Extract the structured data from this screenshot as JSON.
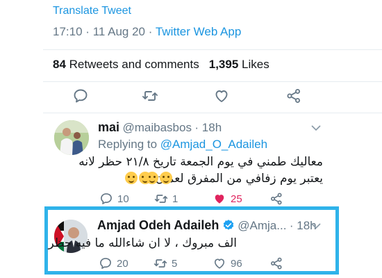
{
  "tweet": {
    "translate_label": "Translate Tweet",
    "time": "17:10",
    "separator": "·",
    "date": "11 Aug 20",
    "app": "Twitter Web App",
    "retweets_count": "84",
    "retweets_label": "Retweets and comments",
    "likes_count": "1,395",
    "likes_label": "Likes"
  },
  "replies": [
    {
      "name": "mai",
      "handle": "@maibasbos",
      "time": "· 18h",
      "replying_prefix": "Replying to",
      "replying_to": "@Amjad_O_Adaileh",
      "line1": "معاليك طمني في يوم الجمعة تاريخ ٢١/٨ حظر لانه",
      "line2": "يعتبر يوم زفافي من المفرق لعمان",
      "reply_count": "10",
      "retweet_count": "1",
      "like_count": "25"
    },
    {
      "name": "Amjad Odeh Adaileh",
      "handle": "@Amja...",
      "time": "· 18h",
      "text": "الف مبروك ، لا ان شاءالله ما فيه حظر",
      "reply_count": "20",
      "retweet_count": "5",
      "like_count": "96"
    }
  ],
  "colors": {
    "accent": "#1b95e0",
    "muted": "#657786",
    "like_active": "#e0245e",
    "highlight_border": "#2fb3ea",
    "verified": "#1da1f2"
  }
}
